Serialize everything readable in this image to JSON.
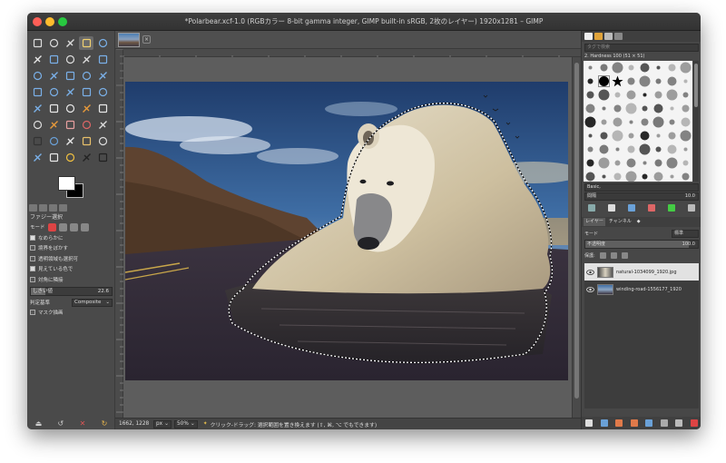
{
  "window": {
    "title": "*Polarbear.xcf-1.0 (RGBカラー 8-bit gamma integer, GIMP built-in sRGB, 2枚のレイヤー) 1920x1281 – GIMP"
  },
  "toolbox": {
    "tools": [
      "rect-select-icon",
      "ellipse-select-icon",
      "free-select-icon",
      "fuzzy-select-icon",
      "color-select-icon",
      "scissors-icon",
      "foreground-select-icon",
      "paths-icon",
      "color-picker-icon",
      "zoom-icon",
      "measure-icon",
      "move-icon",
      "align-icon",
      "crop-icon",
      "unified-transform-icon",
      "rotate-icon",
      "scale-icon",
      "shear-icon",
      "perspective-icon",
      "flip-icon",
      "cage-transform-icon",
      "warp-icon",
      "text-icon",
      "bucket-fill-icon",
      "blend-icon",
      "pencil-icon",
      "paintbrush-icon",
      "eraser-icon",
      "airbrush-icon",
      "ink-icon",
      "mypaint-brush-icon",
      "clone-icon",
      "heal-icon",
      "perspective-clone-icon",
      "blur-icon",
      "smudge-icon",
      "dodge-burn-icon",
      "gradient-icon",
      "foreground-color-icon",
      "background-color-icon"
    ],
    "selected_tool_index": 3,
    "options": {
      "title": "ファジー選択",
      "mode_label": "モード",
      "checkboxes": [
        {
          "label": "なめらかに",
          "checked": true
        },
        {
          "label": "境界をぼかす",
          "checked": false
        },
        {
          "label": "透明領域も選択可",
          "checked": false
        },
        {
          "label": "見えている色で",
          "checked": true
        },
        {
          "label": "対角に隣接",
          "checked": false
        }
      ],
      "threshold_label": "しきい値",
      "threshold_value": "22.6",
      "threshold_fraction": 0.18,
      "criterion_label": "判定基準",
      "criterion_value": "Composite",
      "mask_label": "マスク描画",
      "mask_checked": false
    }
  },
  "status": {
    "coords": "1662, 1228",
    "unit": "px",
    "zoom": "50%",
    "message": "クリック-ドラッグ: 選択範囲を置き換えます (⇧, ⌘, ⌥ でもできます)"
  },
  "brushes": {
    "filter_placeholder": "タグで検索",
    "current": "2. Hardness 100 (51 × 51)",
    "preset": "Basic,",
    "spacing_label": "間隔",
    "spacing_value": "10.0"
  },
  "layers": {
    "tab_layers": "レイヤー",
    "tab_channels": "チャンネル",
    "mode_label": "モード",
    "mode_value": "標準",
    "opacity_label": "不透明度",
    "opacity_value": "100.0",
    "lock_label": "保護:",
    "items": [
      {
        "name": "natural-1034099_1920.jpg",
        "active": true
      },
      {
        "name": "winding-road-1556177_1920",
        "active": false
      }
    ]
  }
}
